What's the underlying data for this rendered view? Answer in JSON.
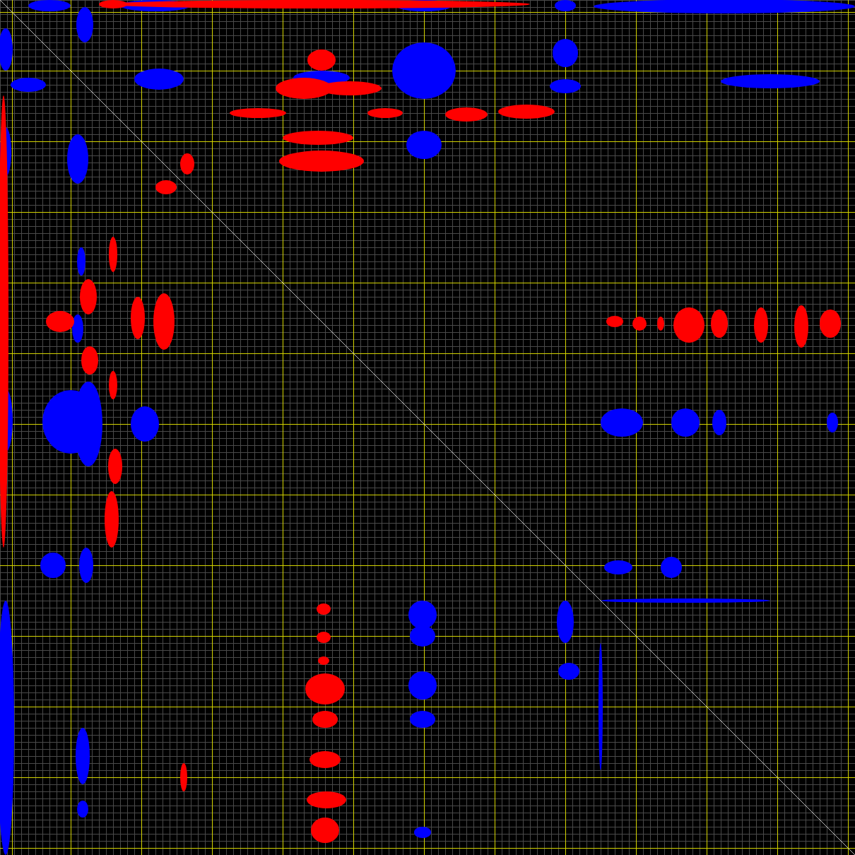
{
  "plot": {
    "kind": "contour_map"
  }
}
